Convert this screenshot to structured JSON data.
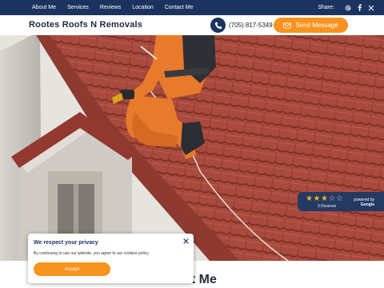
{
  "nav": {
    "links": [
      "About Me",
      "Services",
      "Reviews",
      "Location",
      "Contact Me"
    ],
    "share_label": "Share:",
    "share_icons": [
      "at-icon",
      "facebook-icon",
      "x-icon"
    ]
  },
  "header": {
    "brand": "Rootes Roofs N Removals",
    "phone": "(705) 817-5349",
    "send_label": "Send Message"
  },
  "reviews_widget": {
    "rating": 3,
    "max_rating": 5,
    "count_text": "3 Reviews",
    "powered_by": "powered by",
    "provider": "Google"
  },
  "consent": {
    "title": "We respect your privacy",
    "message": "By continuing to use our website, you agree to our cookies policy.",
    "accept_label": "Accept"
  },
  "section": {
    "title": "About Me"
  },
  "colors": {
    "navy": "#1c3360",
    "orange": "#f7931e",
    "roof": "#a2473b"
  }
}
